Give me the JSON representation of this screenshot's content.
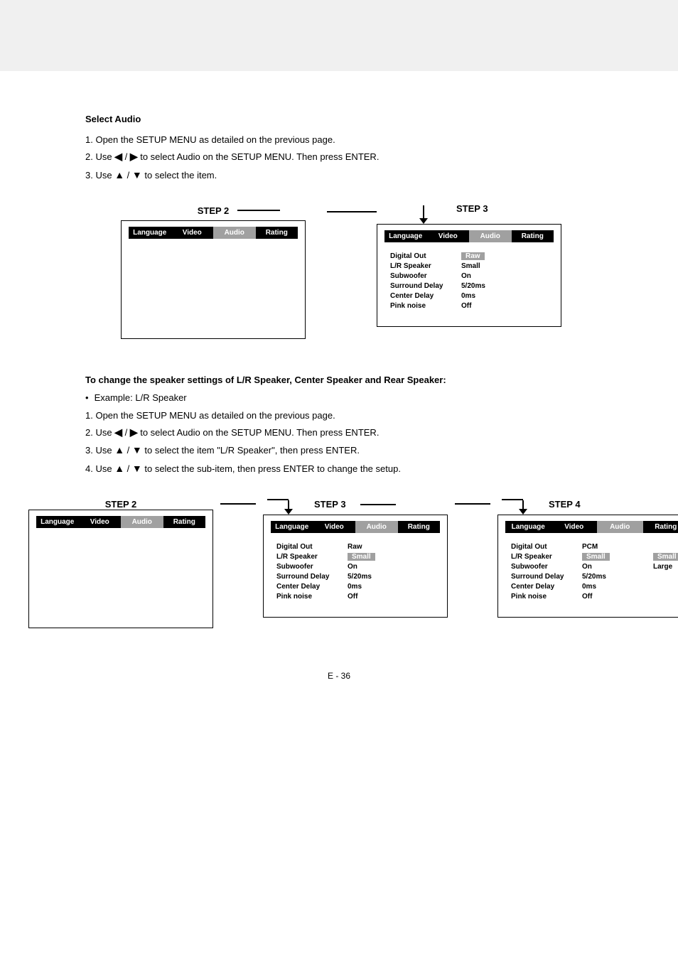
{
  "section1": {
    "heading": "Select Audio",
    "steps": [
      "Open the SETUP MENU as detailed on the previous page.",
      "Use ◀ / ▶ to select Audio on the SETUP MENU. Then press ENTER.",
      "Use ▲ / ▼ to select the item."
    ],
    "step2_label": "STEP 2",
    "step3_label": "STEP 3",
    "tabs": [
      "Language",
      "Video",
      "Audio",
      "Rating"
    ],
    "menu": {
      "digital_out": {
        "label": "Digital Out",
        "value": "Raw"
      },
      "lr_speaker": {
        "label": "L/R Speaker",
        "value": "Small"
      },
      "subwoofer": {
        "label": "Subwoofer",
        "value": "On"
      },
      "surround_delay": {
        "label": "Surround Delay",
        "value": "5/20ms"
      },
      "center_delay": {
        "label": "Center Delay",
        "value": "0ms"
      },
      "pink_noise": {
        "label": "Pink noise",
        "value": "Off"
      }
    }
  },
  "section2": {
    "heading": "To change the speaker settings of L/R Speaker, Center Speaker and Rear Speaker:",
    "bullet_label": "Example: L/R Speaker",
    "steps": [
      "Open the SETUP MENU as detailed on the previous page.",
      "Use ◀ / ▶ to select Audio on the SETUP MENU. Then press ENTER.",
      "Use ▲ / ▼ to select the item \"L/R Speaker\", then press ENTER.",
      "Use ▲ / ▼ to select the sub-item, then press ENTER to change the setup."
    ],
    "step2_label": "STEP 2",
    "step3_label": "STEP 3",
    "step4_label": "STEP 4",
    "step3_menu": {
      "digital_out": {
        "label": "Digital Out",
        "value": "Raw"
      },
      "lr_speaker": {
        "label": "L/R Speaker",
        "value": "Small"
      },
      "subwoofer": {
        "label": "Subwoofer",
        "value": "On"
      },
      "surround_delay": {
        "label": "Surround Delay",
        "value": "5/20ms"
      },
      "center_delay": {
        "label": "Center Delay",
        "value": "0ms"
      },
      "pink_noise": {
        "label": "Pink noise",
        "value": "Off"
      }
    },
    "step4_menu": {
      "digital_out": {
        "label": "Digital Out",
        "value": "PCM"
      },
      "lr_speaker": {
        "label": "L/R Speaker",
        "value": "Small",
        "value2": "Small"
      },
      "subwoofer": {
        "label": "Subwoofer",
        "value": "On",
        "value2": "Large"
      },
      "surround_delay": {
        "label": "Surround Delay",
        "value": "5/20ms"
      },
      "center_delay": {
        "label": "Center Delay",
        "value": "0ms"
      },
      "pink_noise": {
        "label": "Pink noise",
        "value": "Off"
      }
    }
  },
  "page_num": "E - 36"
}
